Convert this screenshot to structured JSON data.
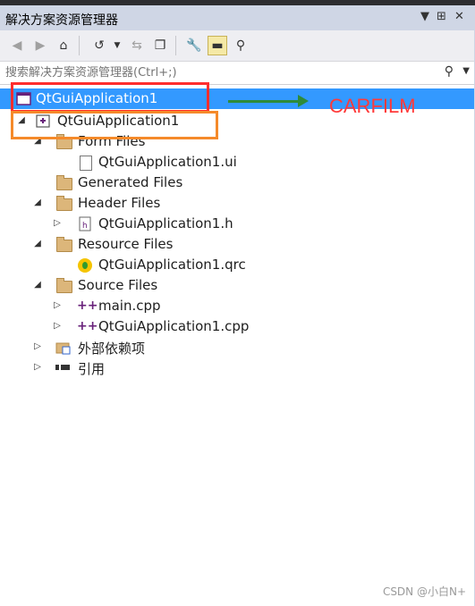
{
  "window": {
    "title": "解决方案资源管理器",
    "pin_glyph": "▼",
    "dock_glyph": "⊞",
    "close_glyph": "✕"
  },
  "toolbar": {
    "icons": [
      "back-icon",
      "forward-icon",
      "home-icon",
      "history-icon",
      "sync-icon",
      "collapse-icon",
      "properties-icon",
      "pending-icon",
      "diagram-icon"
    ]
  },
  "search": {
    "placeholder": "搜索解决方案资源管理器(Ctrl+;)"
  },
  "tree": {
    "solution": {
      "label": "QtGuiApplication1"
    },
    "project": {
      "label": "QtGuiApplication1"
    },
    "items": [
      {
        "label": "Form Files",
        "type": "folder",
        "expander": "◢"
      },
      {
        "label": "QtGuiApplication1.ui",
        "type": "file"
      },
      {
        "label": "Generated Files",
        "type": "folder"
      },
      {
        "label": "Header Files",
        "type": "folder",
        "expander": "◢"
      },
      {
        "label": "QtGuiApplication1.h",
        "type": "file",
        "expander": "▷"
      },
      {
        "label": "Resource Files",
        "type": "folder",
        "expander": "◢"
      },
      {
        "label": "QtGuiApplication1.qrc",
        "type": "qrc"
      },
      {
        "label": "Source Files",
        "type": "folder",
        "expander": "◢"
      },
      {
        "label": "main.cpp",
        "type": "cpp",
        "expander": "▷"
      },
      {
        "label": "QtGuiApplication1.cpp",
        "type": "cpp",
        "expander": "▷"
      },
      {
        "label": "外部依赖项",
        "type": "external",
        "expander": "▷"
      },
      {
        "label": "引用",
        "type": "refs",
        "expander": "▷"
      }
    ]
  },
  "annotation": {
    "text": "CARFILM"
  },
  "watermark": "CSDN @小白N+",
  "colors": {
    "selection": "#3399ff",
    "titlebar": "#cfd6e5",
    "red_box": "#ff2d2d",
    "orange_box": "#f58a2a",
    "arrow": "#2e8b3a"
  }
}
